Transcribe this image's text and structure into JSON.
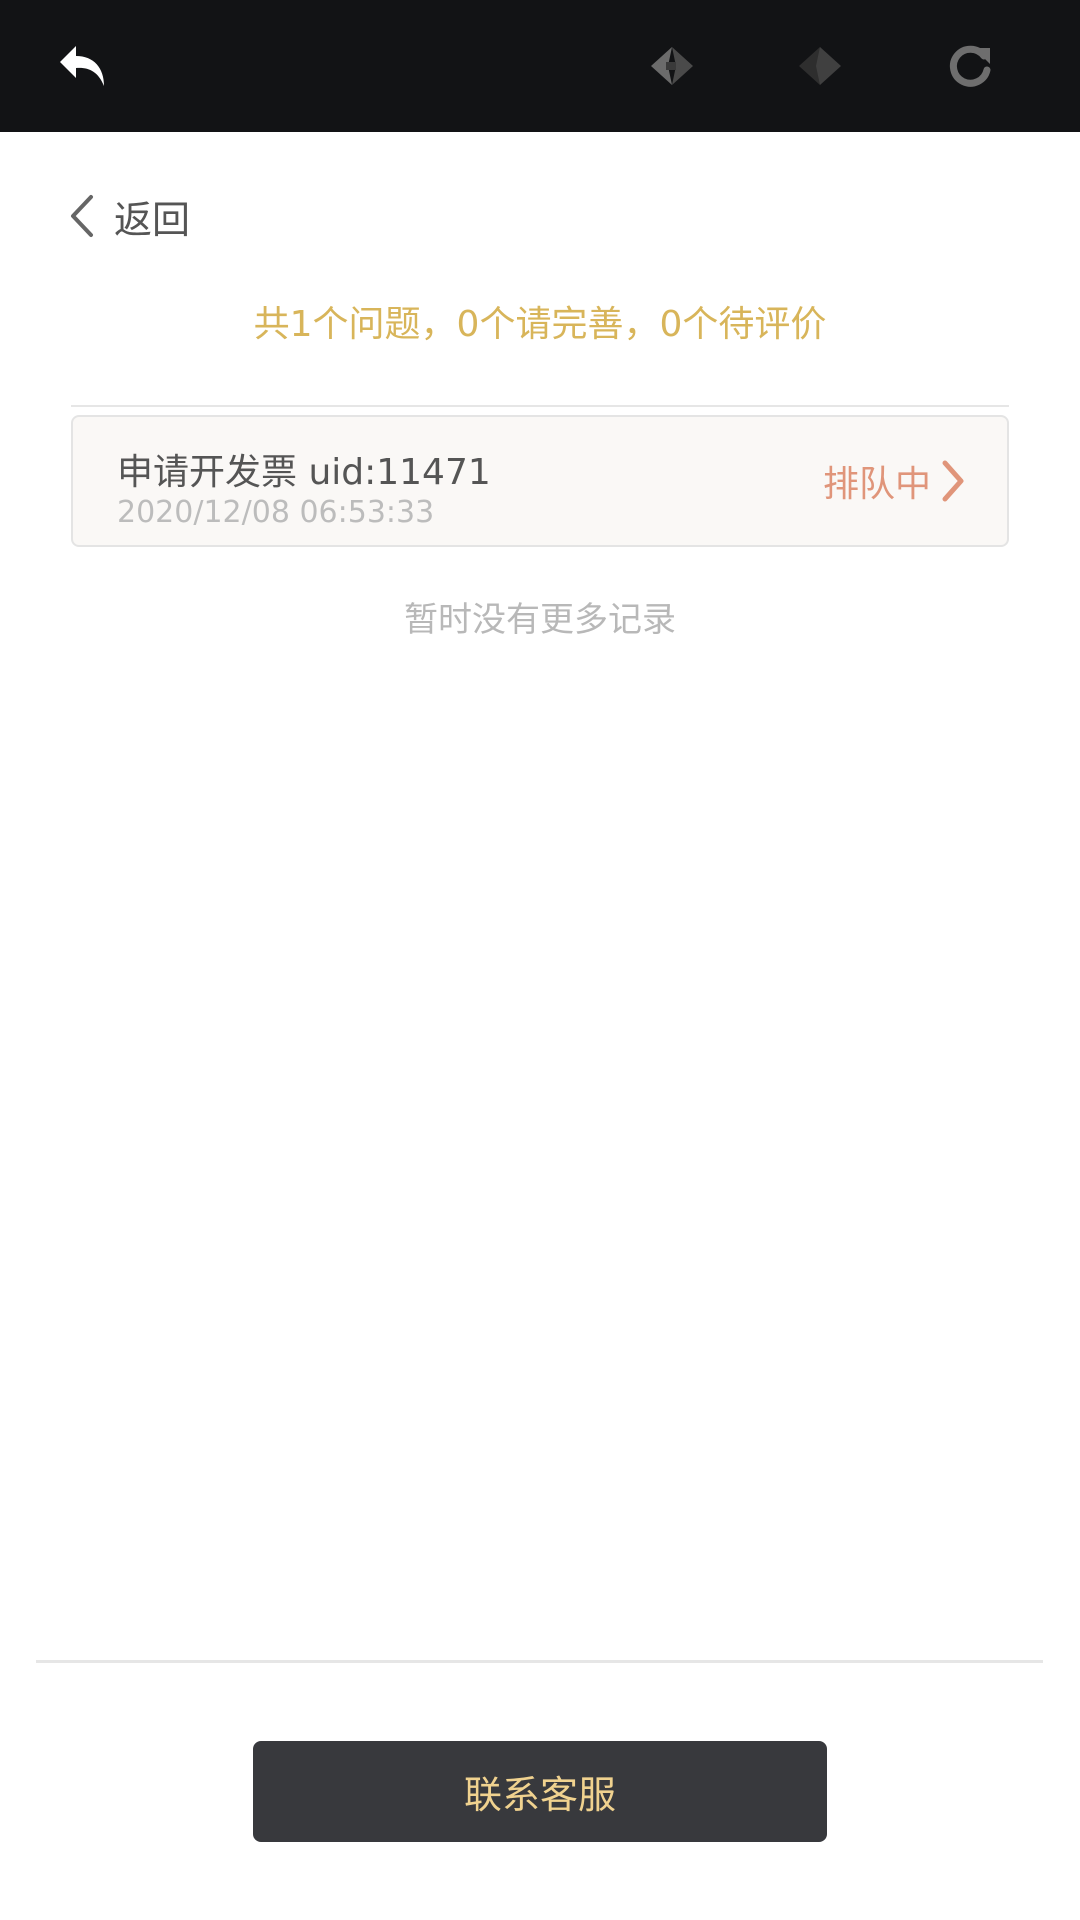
{
  "toolbar": {
    "back_app_icon": "undo-arrow-icon",
    "prev_icon": "diamond-left-icon",
    "next_icon": "diamond-right-icon",
    "refresh_icon": "refresh-icon",
    "bg_color": "#121315"
  },
  "nav": {
    "back_label": "返回"
  },
  "summary": {
    "text": "共1个问题，0个请完善，0个待评价",
    "color": "#d8b55a"
  },
  "tickets": [
    {
      "title": "申请开发票 uid:11471",
      "timestamp": "2020/12/08 06:53:33",
      "status": "排队中",
      "status_color": "#e0957a"
    }
  ],
  "list_end_text": "暂时没有更多记录",
  "footer": {
    "contact_label": "联系客服",
    "button_color": "#38393d",
    "label_color": "#f0d28f"
  }
}
